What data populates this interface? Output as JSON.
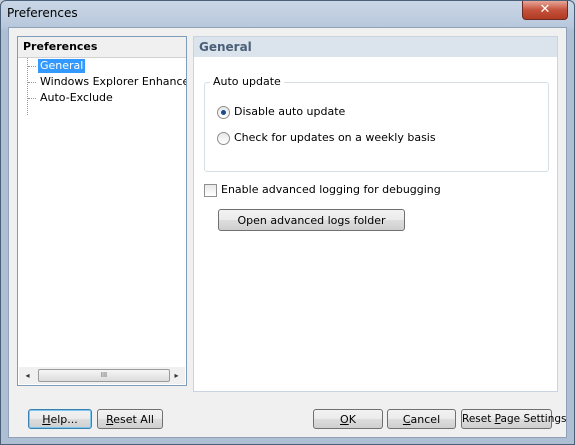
{
  "window": {
    "title": "Preferences",
    "close_glyph": "✕"
  },
  "tree": {
    "header": "Preferences",
    "items": [
      {
        "label": "General",
        "selected": true
      },
      {
        "label": "Windows Explorer Enhancements",
        "selected": false
      },
      {
        "label": "Auto-Exclude",
        "selected": false
      }
    ],
    "scrollbar": {
      "left_arrow": "◂",
      "right_arrow": "▸",
      "grip": "III"
    }
  },
  "panel": {
    "title": "General",
    "auto_update": {
      "group_label": "Auto update",
      "options": [
        {
          "label": "Disable auto update",
          "checked": true
        },
        {
          "label": "Check for updates on a weekly basis",
          "checked": false
        }
      ]
    },
    "logging_checkbox": {
      "label": "Enable advanced logging for debugging",
      "checked": false
    },
    "open_logs_button": "Open advanced logs folder"
  },
  "footer": {
    "help": {
      "pre": "",
      "mnemonic": "H",
      "post": "elp..."
    },
    "reset_all": {
      "pre": "",
      "mnemonic": "R",
      "post": "eset All"
    },
    "ok": {
      "pre": "",
      "mnemonic": "O",
      "post": "K"
    },
    "cancel": {
      "pre": "",
      "mnemonic": "C",
      "post": "ancel"
    },
    "reset_page": {
      "pre": "Reset ",
      "mnemonic": "P",
      "post": "age Settings"
    }
  },
  "colors": {
    "selection": "#3399ff",
    "panel_title": "#4a6078",
    "titlebar": "#c9d6e6",
    "close": "#c4523c"
  }
}
